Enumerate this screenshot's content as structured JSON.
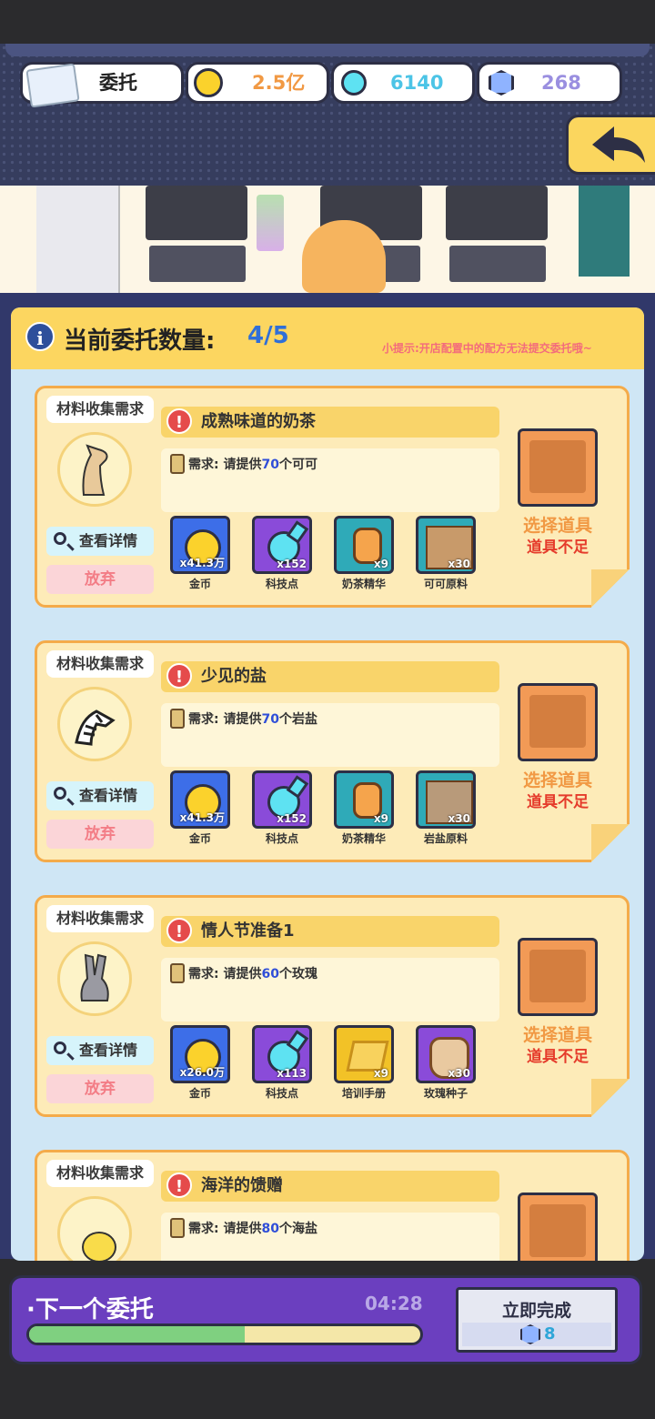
{
  "header": {
    "task_label": "委托",
    "gold": "2.5亿",
    "tech": "6140",
    "gems": "268"
  },
  "panel": {
    "count_label": "当前委托数量:",
    "count_value": "4/5",
    "tip": "小提示:开店配置中的配方无法提交委托哦~"
  },
  "cards": [
    {
      "tag": "材料收集需求",
      "title": "成熟味道的奶茶",
      "req_prefix": "需求:  请提供",
      "req_num": "70",
      "req_suffix": "个可可",
      "detail": "查看详情",
      "abandon": "放弃",
      "select": "选择道具",
      "lack": "道具不足",
      "rewards": [
        {
          "qty": "x41.3万",
          "name": "金币"
        },
        {
          "qty": "x152",
          "name": "科技点"
        },
        {
          "qty": "x9",
          "name": "奶茶精华"
        },
        {
          "qty": "x30",
          "name": "可可原料"
        }
      ]
    },
    {
      "tag": "材料收集需求",
      "title": "少见的盐",
      "req_prefix": "需求:  请提供",
      "req_num": "70",
      "req_suffix": "个岩盐",
      "detail": "查看详情",
      "abandon": "放弃",
      "select": "选择道具",
      "lack": "道具不足",
      "rewards": [
        {
          "qty": "x41.3万",
          "name": "金币"
        },
        {
          "qty": "x152",
          "name": "科技点"
        },
        {
          "qty": "x9",
          "name": "奶茶精华"
        },
        {
          "qty": "x30",
          "name": "岩盐原料"
        }
      ]
    },
    {
      "tag": "材料收集需求",
      "title": "情人节准备1",
      "req_prefix": "需求:  请提供",
      "req_num": "60",
      "req_suffix": "个玫瑰",
      "detail": "查看详情",
      "abandon": "放弃",
      "select": "选择道具",
      "lack": "道具不足",
      "rewards": [
        {
          "qty": "x26.0万",
          "name": "金币"
        },
        {
          "qty": "x113",
          "name": "科技点"
        },
        {
          "qty": "x9",
          "name": "培训手册"
        },
        {
          "qty": "x30",
          "name": "玫瑰种子"
        }
      ]
    },
    {
      "tag": "材料收集需求",
      "title": "海洋的馈赠",
      "req_prefix": "需求:  请提供",
      "req_num": "80",
      "req_suffix": "个海盐"
    }
  ],
  "footer": {
    "next_label": "·下一个委托",
    "timer": "04:28",
    "progress": 0.55,
    "complete_label": "立即完成",
    "complete_cost": "8"
  },
  "colors": {
    "accent_yellow": "#fcd660",
    "panel_blue": "#cfe6f5",
    "footer_purple": "#6b3fbf",
    "req_num_blue": "#2f4ed8",
    "lack_red": "#e53b2b"
  }
}
